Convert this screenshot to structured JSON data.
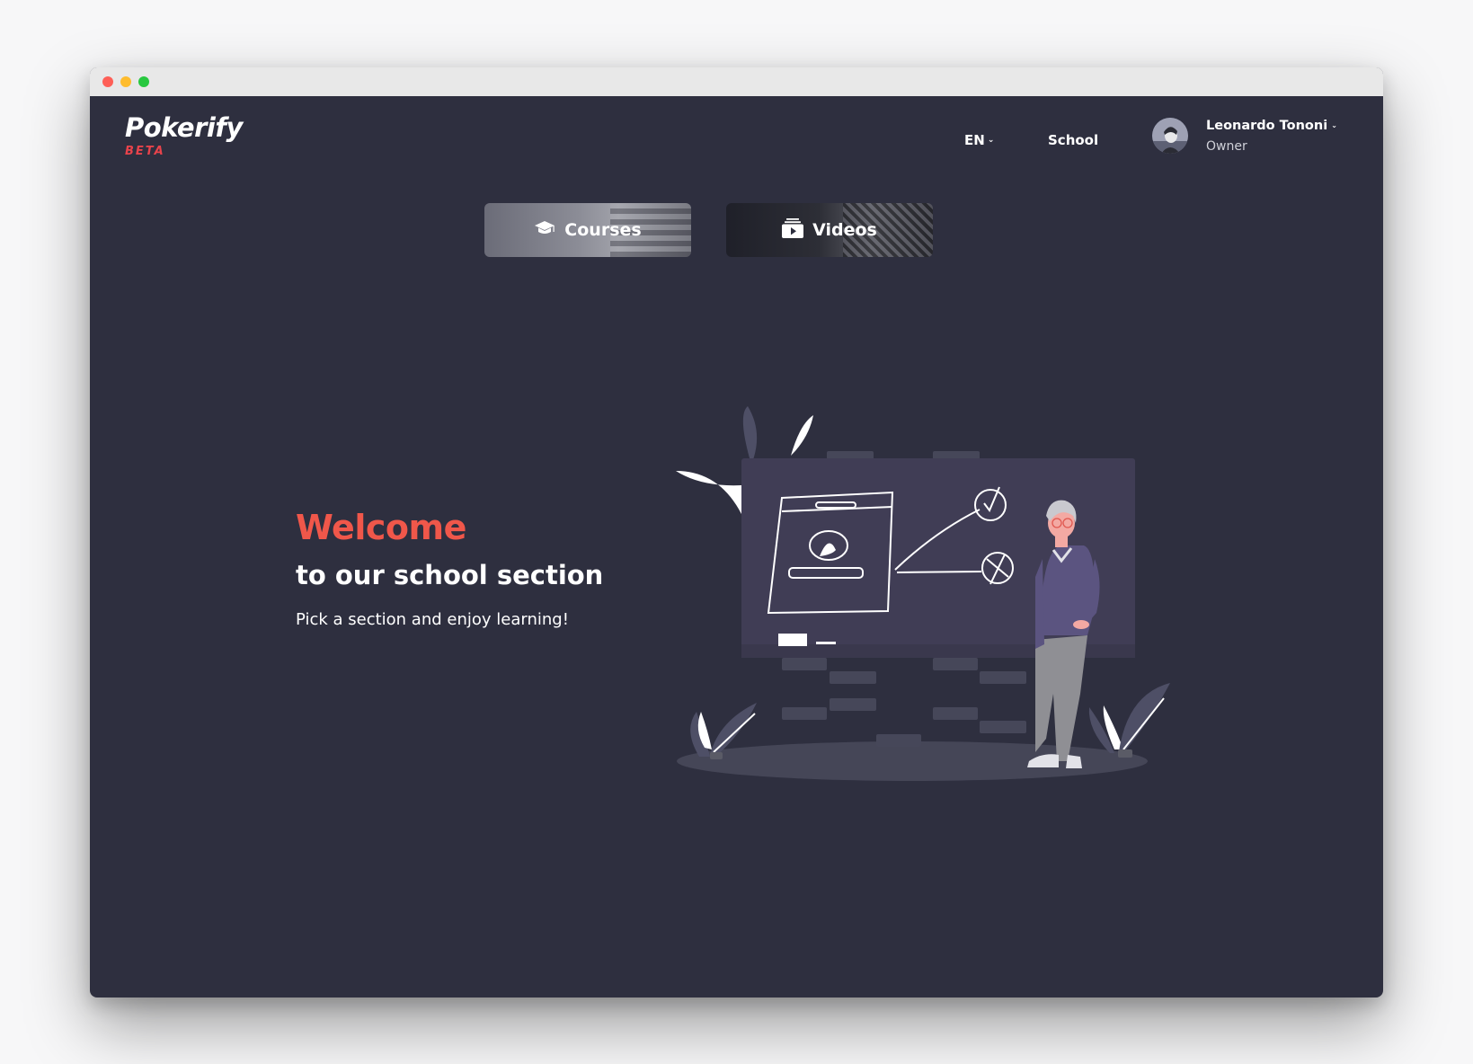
{
  "app": {
    "logo_name": "Pokerify",
    "logo_badge": "BETA"
  },
  "nav": {
    "language": "EN",
    "school_link": "School"
  },
  "user": {
    "name": "Leonardo Tononi",
    "role": "Owner"
  },
  "sections": {
    "courses_label": "Courses",
    "videos_label": "Videos"
  },
  "hero": {
    "title": "Welcome",
    "subtitle": "to our school section",
    "description": "Pick a section and enjoy learning!"
  },
  "colors": {
    "background": "#2e2f3f",
    "accent": "#f0574a",
    "beta": "#e8434b"
  }
}
